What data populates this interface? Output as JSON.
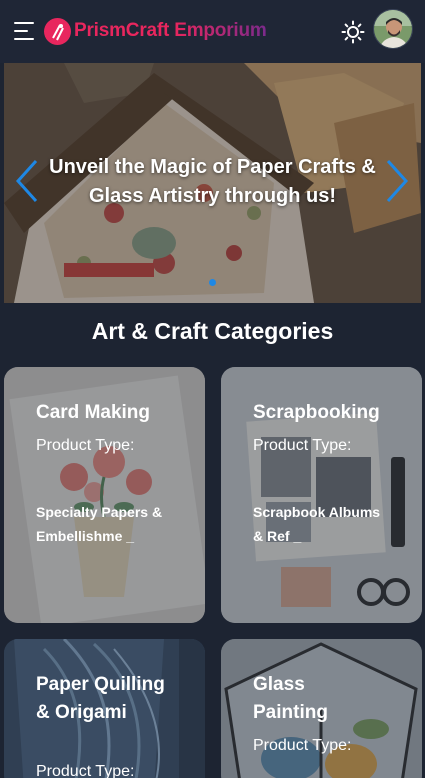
{
  "header": {
    "brand": "PrismCraft Emporium",
    "brand_part1": "PrismCraft ",
    "brand_part2": "Emporium",
    "brand_color": "#e8265e",
    "icons": [
      "hamburger-menu-icon",
      "logo-icon",
      "sun-theme-icon",
      "user-avatar"
    ]
  },
  "banner": {
    "title": "Unveil the Magic of Paper Crafts & Glass Artistry through us!",
    "active_slide": 1,
    "slide_count": 1
  },
  "section": {
    "title": "Art & Craft Categories"
  },
  "categories": [
    {
      "title": "Card Making",
      "type_label": "Product Type:",
      "products": "Specialty Papers & Embellishme _"
    },
    {
      "title": "Scrapbooking",
      "type_label": "Product Type:",
      "products": "Scrapbook Albums & Ref _"
    },
    {
      "title": "Paper Quilling & Origami",
      "type_label": "Product Type:",
      "products": ""
    },
    {
      "title": "Glass Painting",
      "type_label": "Product Type:",
      "products": ""
    }
  ]
}
